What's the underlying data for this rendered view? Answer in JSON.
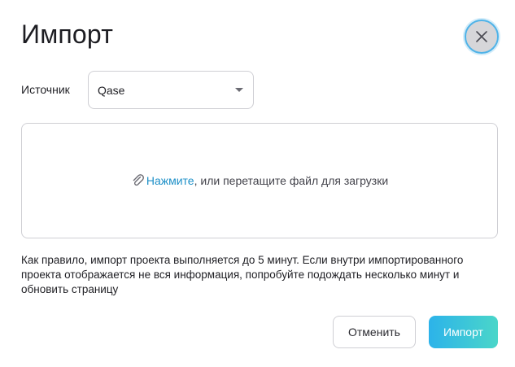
{
  "dialog": {
    "title": "Импорт"
  },
  "source": {
    "label": "Источник",
    "selected": "Qase"
  },
  "dropzone": {
    "link_text": "Нажмите",
    "rest_text": ", или перетащите файл для загрузки"
  },
  "info": {
    "text": "Как правило, импорт проекта выполняется до 5 минут. Если внутри импортированного проекта отображается не вся информация, попробуйте подождать несколько минут и обновить страницу"
  },
  "buttons": {
    "cancel": "Отменить",
    "import": "Импорт"
  },
  "colors": {
    "accent": "#2cb3ea",
    "accent_end": "#4ad6c9",
    "link": "#1e90c8",
    "focus_ring": "#4fb3e8"
  },
  "icons": {
    "close": "close-icon",
    "select_arrow": "caret-down-icon",
    "attach": "paperclip-icon"
  }
}
